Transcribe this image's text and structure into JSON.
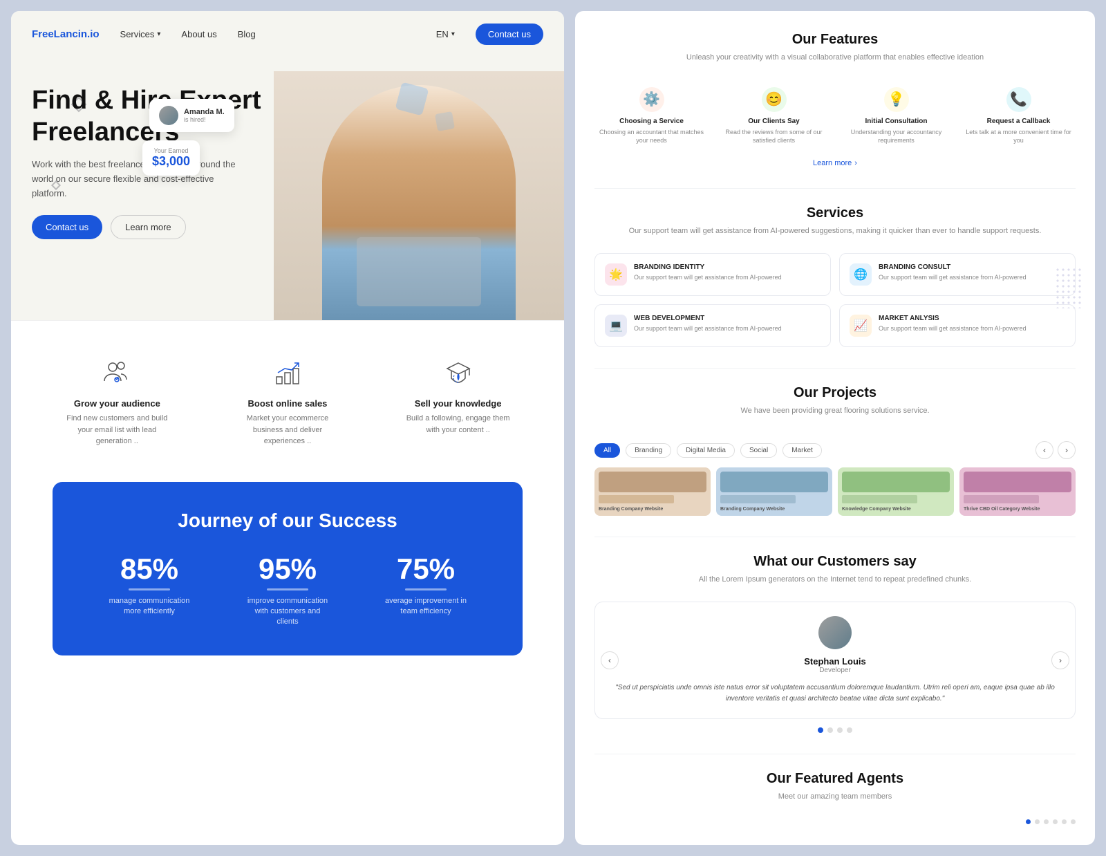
{
  "left": {
    "nav": {
      "logo": "FreeLancin.io",
      "links": [
        "Services",
        "About us",
        "Blog"
      ],
      "lang": "EN",
      "contact_btn": "Contact us"
    },
    "hero": {
      "title": "Find & Hire Expert Freelancers",
      "subtitle": "Work with the best freelance talent from around the world on our secure flexible and cost-effective platform.",
      "btn_contact": "Contact us",
      "btn_learn": "Learn more",
      "float_name": "Amanda M.",
      "float_hired": "is hired!",
      "float_earned_label": "Your Earned",
      "float_earned_amount": "$3,000"
    },
    "features": [
      {
        "icon": "👥",
        "title": "Grow your audience",
        "desc": "Find new customers and build your email list with lead generation .."
      },
      {
        "icon": "📊",
        "title": "Boost online sales",
        "desc": "Market your ecommerce business and deliver experiences .."
      },
      {
        "icon": "🎓",
        "title": "Sell your knowledge",
        "desc": "Build a following, engage them with your content .."
      }
    ],
    "stats": {
      "title": "Journey of our Success",
      "items": [
        {
          "number": "85%",
          "label": "manage communication more efficiently"
        },
        {
          "number": "95%",
          "label": "improve communication with customers and clients"
        },
        {
          "number": "75%",
          "label": "average improvement in team efficiency"
        }
      ]
    }
  },
  "right": {
    "our_features": {
      "title": "Our Features",
      "subtitle": "Unleash your creativity with a visual collaborative platform that enables effective ideation",
      "items": [
        {
          "icon": "⚙️",
          "color": "#ff6b35",
          "bg": "#fff0ea",
          "name": "Choosing a Service",
          "desc": "Choosing an accountant that matches your needs"
        },
        {
          "icon": "😊",
          "color": "#4caf50",
          "bg": "#eafbea",
          "name": "Our Clients Say",
          "desc": "Read the reviews from some of our satisfied clients"
        },
        {
          "icon": "💡",
          "color": "#ffc107",
          "bg": "#fffbe6",
          "name": "Initial Consultation",
          "desc": "Understanding your accountancy requirements"
        },
        {
          "icon": "📞",
          "color": "#00bcd4",
          "bg": "#e0f7fa",
          "name": "Request a Callback",
          "desc": "Lets talk at a more convenient time for you"
        }
      ],
      "learn_more": "Learn more"
    },
    "services": {
      "title": "Services",
      "subtitle": "Our support team will get assistance from AI-powered suggestions, making it quicker than ever to handle support requests.",
      "items": [
        {
          "icon": "🌟",
          "color": "#e91e63",
          "bg": "#fce4ec",
          "name": "BRANDING IDENTITY",
          "desc": "Our support team will get assistance from AI-powered"
        },
        {
          "icon": "🌐",
          "color": "#2196f3",
          "bg": "#e3f2fd",
          "name": "BRANDING CONSULT",
          "desc": "Our support team will get assistance from AI-powered"
        },
        {
          "icon": "💻",
          "color": "#3f51b5",
          "bg": "#e8eaf6",
          "name": "WEB DEVELOPMENT",
          "desc": "Our support team will get assistance from AI-powered"
        },
        {
          "icon": "📈",
          "color": "#ff9800",
          "bg": "#fff3e0",
          "name": "MARKET ANLYSIS",
          "desc": "Our support team will get assistance from AI-powered"
        }
      ]
    },
    "projects": {
      "title": "Our Projects",
      "subtitle": "We have been providing great flooring solutions service.",
      "tabs": [
        "All",
        "Branding",
        "Digital Media",
        "Social",
        "Market"
      ],
      "active_tab": "All",
      "items": [
        {
          "label": "Branding Company Website",
          "bg": "#e8d5c0"
        },
        {
          "label": "Branding Company Website",
          "bg": "#c0d5e8"
        },
        {
          "label": "Knowledge Company Website",
          "bg": "#d0e8c0"
        },
        {
          "label": "Thrive CBD Oil Category Website",
          "bg": "#e8c0d5"
        }
      ]
    },
    "customers": {
      "title": "What our Customers say",
      "subtitle": "All the Lorem Ipsum generators on the Internet tend to repeat predefined chunks.",
      "testimonial": {
        "name": "Stephan Louis",
        "role": "Developer",
        "text": "\"Sed ut perspiciatis unde omnis iste natus error sit voluptatem accusantium doloremque laudantium. Utrim reli operi am, eaque ipsa quae ab illo inventore veritatis et quasi architecto beatae vitae dicta sunt explicabo.\""
      },
      "dots": [
        true,
        false,
        false,
        false
      ]
    },
    "featured_agents": {
      "title": "Our Featured Agents",
      "subtitle": "Meet our amazing team members",
      "dots": [
        true,
        false,
        false,
        false,
        false,
        false
      ]
    }
  }
}
